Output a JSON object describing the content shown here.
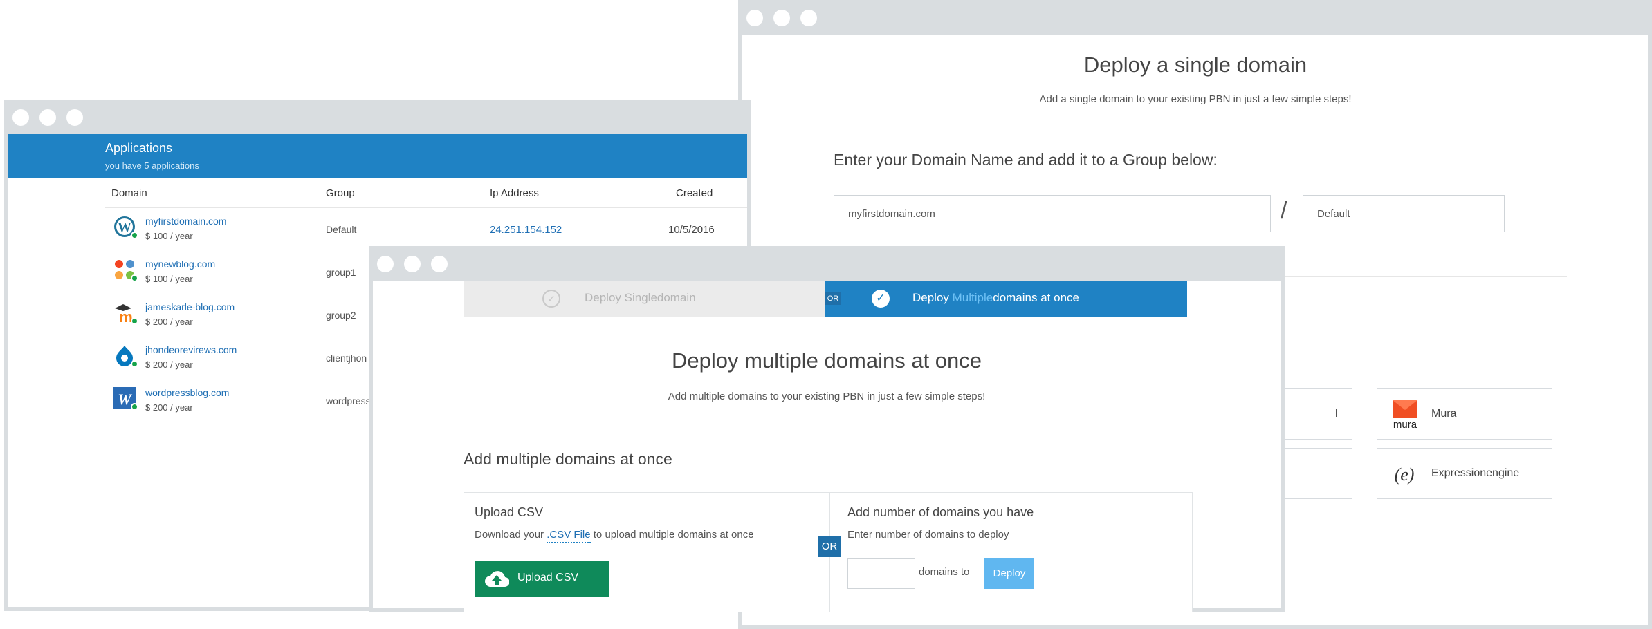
{
  "applications": {
    "title": "Applications",
    "subtitle": "you have 5 applications",
    "columns": {
      "domain": "Domain",
      "group": "Group",
      "ip": "Ip Address",
      "created": "Created"
    },
    "rows": [
      {
        "domain": "myfirstdomain.com",
        "price": "$ 100 / year",
        "group": "Default",
        "ip": "24.251.154.152",
        "created": "10/5/2016",
        "icon": "wordpress-icon"
      },
      {
        "domain": "mynewblog.com",
        "price": "$ 100 / year",
        "group": "group1",
        "ip": "",
        "created": "",
        "icon": "joomla-icon"
      },
      {
        "domain": "jameskarle-blog.com",
        "price": "$ 200 / year",
        "group": "group2",
        "ip": "",
        "created": "",
        "icon": "moodle-icon"
      },
      {
        "domain": "jhondeorevirews.com",
        "price": "$ 200 / year",
        "group": "clientjhon",
        "ip": "",
        "created": "",
        "icon": "drupal-icon"
      },
      {
        "domain": "wordpressblog.com",
        "price": "$ 200 / year",
        "group": "wordpress",
        "ip": "",
        "created": "",
        "icon": "wpbakery-icon"
      }
    ]
  },
  "single": {
    "title": "Deploy a single domain",
    "subtitle": "Add a single domain to your existing PBN in just a few simple steps!",
    "label": "Enter your Domain Name and add it to a Group below:",
    "domain_value": "myfirstdomain.com",
    "group_value": "Default",
    "slash": "/",
    "apps": [
      {
        "name": "Mura",
        "icon": "mura-icon"
      },
      {
        "name": "Expressionengine",
        "icon": "expressionengine-icon"
      },
      {
        "name": "l",
        "icon": ""
      }
    ]
  },
  "multi": {
    "tab_single": "Deploy Singledomain",
    "tab_multi_pre": "Deploy ",
    "tab_multi_hl": "Multiple",
    "tab_multi_post": "domains at once",
    "or_small": "OR",
    "title": "Deploy multiple domains at once",
    "subtitle": "Add multiple domains to your existing PBN in just a few simple steps!",
    "label": "Add multiple domains at once",
    "upload": {
      "heading": "Upload CSV",
      "text_pre": "Download your ",
      "link": ".CSV File",
      "text_post": " to upload multiple domains at once",
      "button": "Upload CSV"
    },
    "or_mid": "OR",
    "count": {
      "heading": "Add number of domains you have",
      "text": "Enter number of domains to deploy",
      "suffix": "domains to",
      "button": "Deploy"
    }
  },
  "colors": {
    "accent": "#1f82c4",
    "upload_green": "#0f8a5a",
    "deploy_light": "#60b7f0",
    "status_online": "#16a34a"
  }
}
